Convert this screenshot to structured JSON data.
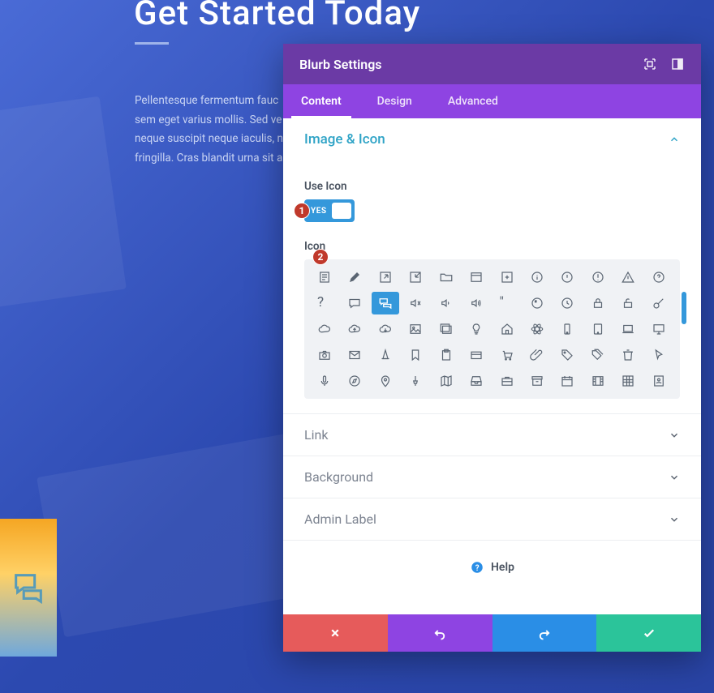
{
  "page": {
    "title": "Get Started Today",
    "body": "Pellentesque fermentum fauc sem eget varius mollis. Sed ve neque suscipit neque iaculis, n fringilla. Cras blandit urna sit a"
  },
  "modal": {
    "title": "Blurb Settings",
    "tabs": {
      "content": "Content",
      "design": "Design",
      "advanced": "Advanced"
    },
    "sections": {
      "image_icon": "Image & Icon",
      "link": "Link",
      "background": "Background",
      "admin_label": "Admin Label"
    },
    "fields": {
      "use_icon_label": "Use Icon",
      "icon_label": "Icon",
      "toggle_on": "YES"
    },
    "help": "Help"
  },
  "markers": {
    "one": "1",
    "two": "2"
  }
}
